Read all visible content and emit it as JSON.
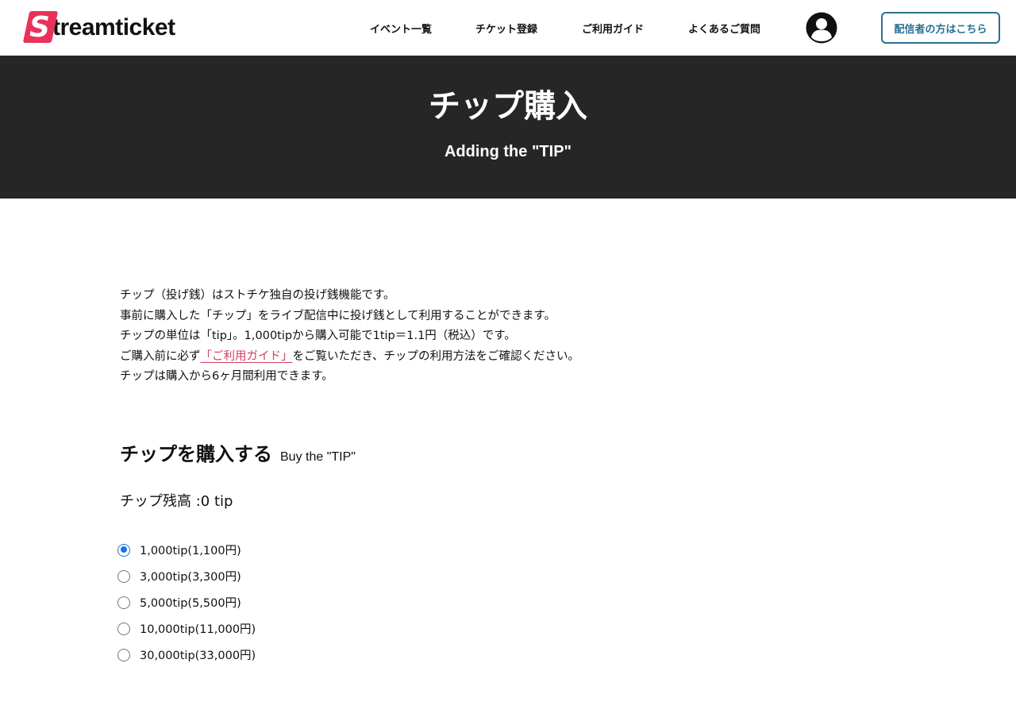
{
  "header": {
    "logo_letter": "S",
    "logo_text": "treamticket",
    "nav": [
      "イベント一覧",
      "チケット登録",
      "ご利用ガイド",
      "よくあるご質問"
    ],
    "account_icon": "user-circle-icon",
    "cta_label": "配信者の方はこちら"
  },
  "hero": {
    "title": "チップ購入",
    "subtitle": "Adding the \"TIP\""
  },
  "intro": {
    "line1": "チップ（投げ銭）はストチケ独自の投げ銭機能です。",
    "line2": "事前に購入した「チップ」をライブ配信中に投げ銭として利用することができます。",
    "line3": "チップの単位は「tip」。1,000tipから購入可能で1tip＝1.1円（税込）です。",
    "line4_prefix": "ご購入前に必ず",
    "line4_link": "「ご利用ガイド」",
    "line4_suffix": "をご覧いただき、チップの利用方法をご確認ください。",
    "line5": "チップは購入から6ヶ月間利用できます。"
  },
  "purchase": {
    "title": "チップを購入する",
    "subtitle": "Buy the \"TIP\"",
    "balance": "チップ残高 :0 tip",
    "selected_index": 0,
    "options": [
      "1,000tip(1,100円)",
      "3,000tip(3,300円)",
      "5,000tip(5,500円)",
      "10,000tip(11,000円)",
      "30,000tip(33,000円)"
    ]
  },
  "colors": {
    "brand": "#e8325a",
    "hero_bg": "#262626",
    "cta": "#2a6f93",
    "link": "#d2415f",
    "radio_selected": "#1a73e8"
  }
}
